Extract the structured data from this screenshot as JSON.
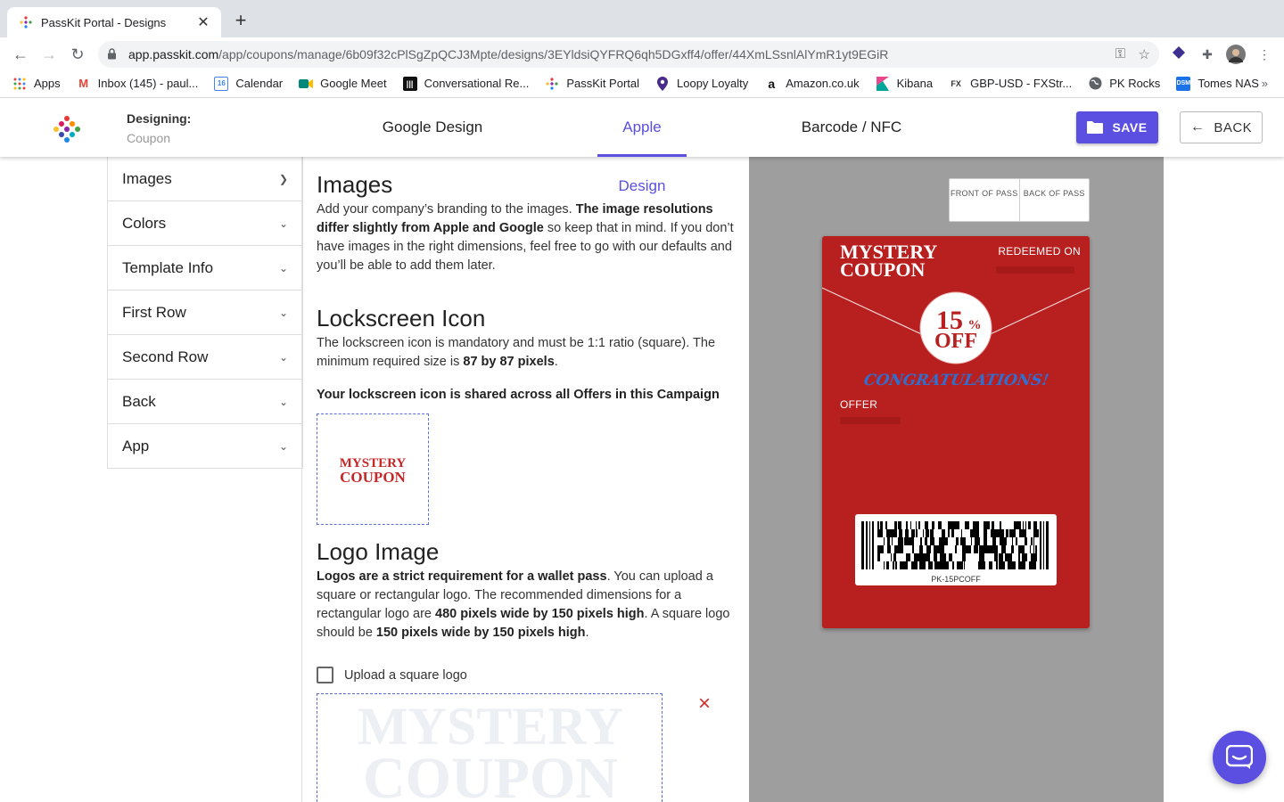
{
  "browser": {
    "tab_title": "PassKit Portal - Designs",
    "url_host": "app.passkit.com",
    "url_path": "/app/coupons/manage/6b09f32cPlSgZpQCJ3Mpte/designs/3EYldsiQYFRQ6qh5DGxff4/offer/44XmLSsnlAlYmR1yt9EGiR",
    "bookmarks": [
      {
        "label": "Apps",
        "icon": "apps-grid-icon"
      },
      {
        "label": "Inbox (145) - paul...",
        "icon": "gmail-icon"
      },
      {
        "label": "Calendar",
        "icon": "calendar-icon"
      },
      {
        "label": "Google Meet",
        "icon": "meet-icon"
      },
      {
        "label": "Conversational Re...",
        "icon": "bars-icon"
      },
      {
        "label": "PassKit Portal",
        "icon": "passkit-icon"
      },
      {
        "label": "Loopy Loyalty",
        "icon": "pin-icon"
      },
      {
        "label": "Amazon.co.uk",
        "icon": "amazon-icon"
      },
      {
        "label": "Kibana",
        "icon": "kibana-icon"
      },
      {
        "label": "GBP-USD - FXStr...",
        "icon": "fx-icon"
      },
      {
        "label": "PK Rocks",
        "icon": "globe-icon"
      },
      {
        "label": "Tomes NAS",
        "icon": "dsm-icon"
      }
    ],
    "bookmarks_more": "»"
  },
  "header": {
    "designing_label": "Designing:",
    "designing_value": "Coupon",
    "tabs": [
      "Google Design",
      "Apple Design",
      "Barcode / NFC"
    ],
    "active_tab": "Apple Design",
    "save_label": "SAVE",
    "back_label": "BACK"
  },
  "sidebar": {
    "items": [
      "Images",
      "Colors",
      "Template Info",
      "First Row",
      "Second Row",
      "Back",
      "App"
    ]
  },
  "main": {
    "images_title": "Images",
    "images_body_1": "Add your company’s branding to the images. ",
    "images_body_bold": "The image resolutions differ slightly from Apple and Google",
    "images_body_2": " so keep that in mind. If you don’t have images in the right dimensions, feel free to go with our defaults and you’ll be able to add them later.",
    "lock_title": "Lockscreen Icon",
    "lock_body_1": "The lockscreen icon is mandatory and must be 1:1 ratio (square). The minimum required size is ",
    "lock_body_bold": "87 by 87 pixels",
    "lock_body_2": ".",
    "lock_shared": "Your lockscreen icon is shared across all Offers in this Campaign",
    "logo_title": "Logo Image",
    "logo_body_b1": "Logos are a strict requirement for a wallet pass",
    "logo_body_1": ". You can upload a square or rectangular logo. The recommended dimensions for a rectangular logo are ",
    "logo_body_b2": "480 pixels wide by 150 pixels high",
    "logo_body_2": ". A square logo should be ",
    "logo_body_b3": "150 pixels wide by 150 pixels high",
    "logo_body_3": ".",
    "square_logo_label": "Upload a square logo",
    "remove_icon": "×"
  },
  "brand_images": {
    "logo_line1": "MYSTERY",
    "logo_line2": "COUPON"
  },
  "preview": {
    "front_label": "FRONT OF PASS",
    "back_label": "BACK OF PASS",
    "redeemed_label": "REDEEMED ON",
    "badge_percent": "15",
    "badge_pct_sign": "%",
    "badge_off": "OFF",
    "congrats": "CONGRATULATIONS!",
    "offer_label": "OFFER",
    "barcode_text": "PK-15PCOFF"
  },
  "colors": {
    "accent": "#5a4fe0",
    "pass_red": "#b8201f",
    "preview_bg": "#9e9e9e",
    "congrats_blue": "#2f6fd0"
  }
}
